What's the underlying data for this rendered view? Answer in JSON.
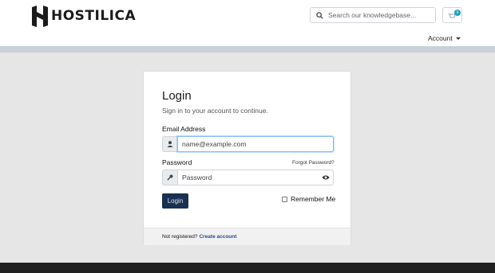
{
  "header": {
    "brand": "HOSTILICA",
    "search_placeholder": "Search our knowledgebase...",
    "cart_count": "0",
    "account_label": "Account"
  },
  "login": {
    "title": "Login",
    "subtitle": "Sign in to your account to continue.",
    "email_label": "Email Address",
    "email_placeholder": "name@example.com",
    "password_label": "Password",
    "password_placeholder": "Password",
    "forgot_label": "Forgot Password?",
    "submit_label": "Login",
    "remember_label": "Remember Me"
  },
  "footer": {
    "prompt": "Not registered?",
    "link": "Create account"
  },
  "colors": {
    "brand_dark": "#183153",
    "accent_badge": "#17a2b8",
    "link": "#1e4c8a",
    "page_bg": "#e6e6e6"
  },
  "icons": [
    "hostilica-logo-icon",
    "search-icon",
    "cart-icon",
    "chevron-down-icon",
    "user-icon",
    "key-icon",
    "eye-icon"
  ]
}
